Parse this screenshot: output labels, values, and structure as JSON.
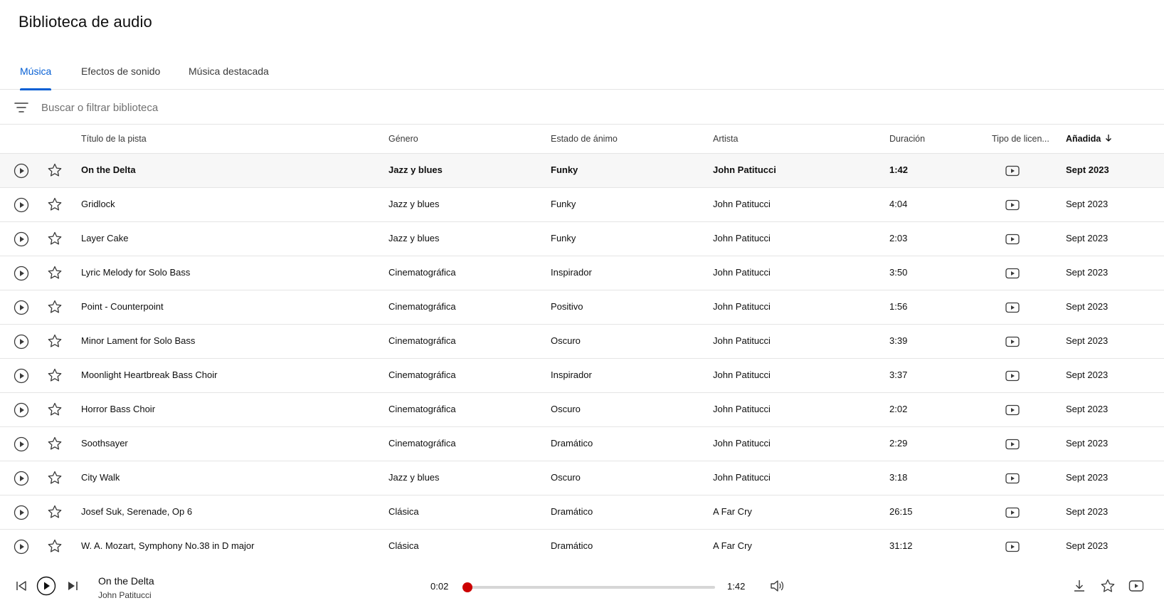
{
  "page": {
    "title": "Biblioteca de audio"
  },
  "tabs": [
    {
      "label": "Música",
      "active": true
    },
    {
      "label": "Efectos de sonido",
      "active": false
    },
    {
      "label": "Música destacada",
      "active": false
    }
  ],
  "filter": {
    "placeholder": "Buscar o filtrar biblioteca",
    "value": "",
    "icon": "filter-icon"
  },
  "table": {
    "headers": {
      "title": "Título de la pista",
      "genre": "Género",
      "mood": "Estado de ánimo",
      "artist": "Artista",
      "duration": "Duración",
      "license": "Tipo de licen...",
      "added": "Añadida"
    },
    "sort": {
      "column": "added",
      "direction": "descending"
    },
    "rows": [
      {
        "title": "On the Delta",
        "genre": "Jazz y blues",
        "mood": "Funky",
        "artist": "John Patitucci",
        "duration": "1:42",
        "added": "Sept 2023",
        "selected": true
      },
      {
        "title": "Gridlock",
        "genre": "Jazz y blues",
        "mood": "Funky",
        "artist": "John Patitucci",
        "duration": "4:04",
        "added": "Sept 2023"
      },
      {
        "title": "Layer Cake",
        "genre": "Jazz y blues",
        "mood": "Funky",
        "artist": "John Patitucci",
        "duration": "2:03",
        "added": "Sept 2023"
      },
      {
        "title": "Lyric Melody for Solo Bass",
        "genre": "Cinematográfica",
        "mood": "Inspirador",
        "artist": "John Patitucci",
        "duration": "3:50",
        "added": "Sept 2023"
      },
      {
        "title": "Point - Counterpoint",
        "genre": "Cinematográfica",
        "mood": "Positivo",
        "artist": "John Patitucci",
        "duration": "1:56",
        "added": "Sept 2023"
      },
      {
        "title": "Minor Lament for Solo Bass",
        "genre": "Cinematográfica",
        "mood": "Oscuro",
        "artist": "John Patitucci",
        "duration": "3:39",
        "added": "Sept 2023"
      },
      {
        "title": "Moonlight Heartbreak Bass Choir",
        "genre": "Cinematográfica",
        "mood": "Inspirador",
        "artist": "John Patitucci",
        "duration": "3:37",
        "added": "Sept 2023"
      },
      {
        "title": "Horror Bass Choir",
        "genre": "Cinematográfica",
        "mood": "Oscuro",
        "artist": "John Patitucci",
        "duration": "2:02",
        "added": "Sept 2023"
      },
      {
        "title": "Soothsayer",
        "genre": "Cinematográfica",
        "mood": "Dramático",
        "artist": "John Patitucci",
        "duration": "2:29",
        "added": "Sept 2023"
      },
      {
        "title": "City Walk",
        "genre": "Jazz y blues",
        "mood": "Oscuro",
        "artist": "John Patitucci",
        "duration": "3:18",
        "added": "Sept 2023"
      },
      {
        "title": "Josef Suk, Serenade, Op 6",
        "genre": "Clásica",
        "mood": "Dramático",
        "artist": "A Far Cry",
        "duration": "26:15",
        "added": "Sept 2023"
      },
      {
        "title": "W. A. Mozart, Symphony No.38 in D major",
        "genre": "Clásica",
        "mood": "Dramático",
        "artist": "A Far Cry",
        "duration": "31:12",
        "added": "Sept 2023"
      }
    ]
  },
  "player": {
    "title": "On the Delta",
    "artist": "John Patitucci",
    "current_time": "0:02",
    "total_time": "1:42",
    "progress_fraction": 0.02,
    "accent_color": "#cc0000"
  },
  "colors": {
    "accent": "#065fd4",
    "progress": "#cc0000",
    "divider": "#e5e5e5"
  }
}
